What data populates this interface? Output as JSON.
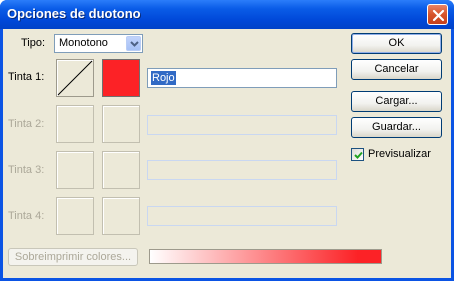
{
  "window": {
    "title": "Opciones de duotono",
    "close_icon": "close-icon"
  },
  "tipo": {
    "label": "Tipo:",
    "selected": "Monotono"
  },
  "inks": [
    {
      "label": "Tinta 1:",
      "name": "Rojo",
      "enabled": true,
      "color": "#fc2226"
    },
    {
      "label": "Tinta 2:",
      "name": "",
      "enabled": false
    },
    {
      "label": "Tinta 3:",
      "name": "",
      "enabled": false
    },
    {
      "label": "Tinta 4:",
      "name": "",
      "enabled": false
    }
  ],
  "buttons": {
    "ok": "OK",
    "cancel": "Cancelar",
    "load": "Cargar...",
    "save": "Guardar..."
  },
  "preview": {
    "label": "Previsualizar",
    "checked": true
  },
  "overprint_button": "Sobreimprimir colores...",
  "colors": {
    "titlebar": "#0a5ce7",
    "dialog_bg": "#ece9d8",
    "ink_red": "#fc2226",
    "selection": "#316ac5"
  }
}
